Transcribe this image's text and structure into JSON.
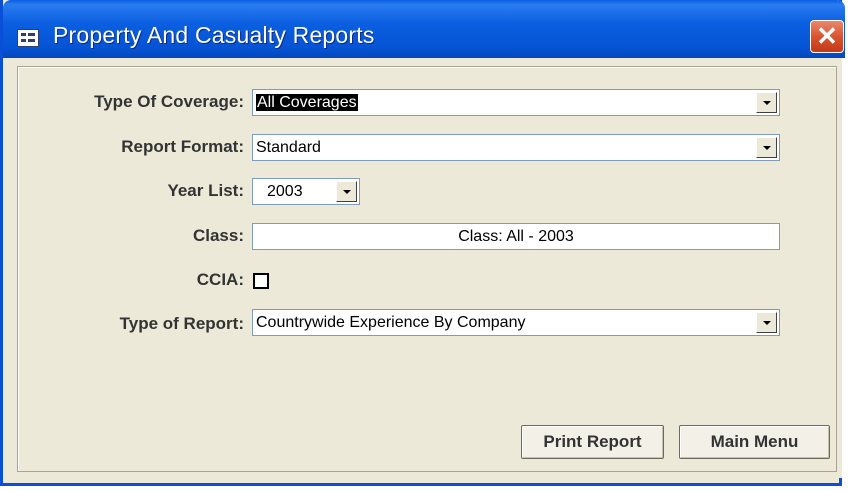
{
  "window": {
    "title": "Property And Casualty Reports"
  },
  "icons": {
    "app": "form-icon",
    "close": "close-icon",
    "dropdown": "chevron-down-icon"
  },
  "colors": {
    "titlebar": "#0a5fe6",
    "close": "#d8502c",
    "body": "#ece9d8",
    "field_border": "#7f9db9"
  },
  "form": {
    "coverage": {
      "label": "Type Of Coverage:",
      "value": "All Coverages"
    },
    "format": {
      "label": "Report Format:",
      "value": "Standard"
    },
    "year": {
      "label": "Year List:",
      "value": "2003"
    },
    "class": {
      "label": "Class:",
      "value": "Class: All - 2003"
    },
    "ccia": {
      "label": "CCIA:",
      "checked": false
    },
    "report_type": {
      "label": "Type of Report:",
      "value": "Countrywide Experience By Company"
    }
  },
  "buttons": {
    "print": "Print Report",
    "main_menu": "Main Menu",
    "close_glyph": "✕"
  }
}
